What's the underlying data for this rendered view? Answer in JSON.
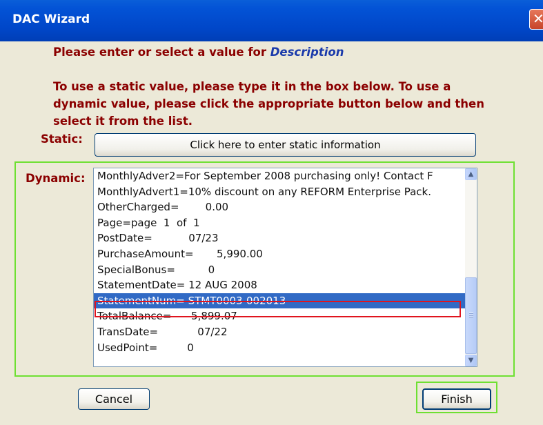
{
  "window": {
    "title": "DAC Wizard",
    "close_glyph": "✕"
  },
  "prompt": {
    "text": "Please enter or select a value for ",
    "field": "Description"
  },
  "instructions": "To use a static value, please type it in the box below.  To use a dynamic value, please click the appropriate button below and then select it from the list.",
  "static": {
    "label": "Static:",
    "button_label": "Click here to enter static information"
  },
  "dynamic": {
    "label": "Dynamic:",
    "items": [
      "MonthlyAdver2=For September 2008 purchasing only! Contact F",
      "MonthlyAdvert1=10% discount on any REFORM Enterprise Pack.",
      "OtherCharged=        0.00",
      "Page=page  1  of  1",
      "PostDate=           07/23",
      "PurchaseAmount=       5,990.00",
      "SpecialBonus=          0",
      "StatementDate= 12 AUG 2008",
      "StatementNum= STMT0003-002013",
      "TotalBalance=      5,899.07",
      "TransDate=            07/22",
      "UsedPoint=         0"
    ],
    "selected_item": "StatementNum= STMT0003-002013",
    "scroll_up_glyph": "▲",
    "scroll_down_glyph": "▼"
  },
  "buttons": {
    "cancel": "Cancel",
    "finish": "Finish"
  },
  "colors": {
    "titlebar": "#0353D6",
    "label_text": "#8B0000",
    "field_name": "#1A3AAB",
    "selection": "#316AC5",
    "highlight_green": "#6EE032",
    "highlight_red": "#E0141E"
  }
}
